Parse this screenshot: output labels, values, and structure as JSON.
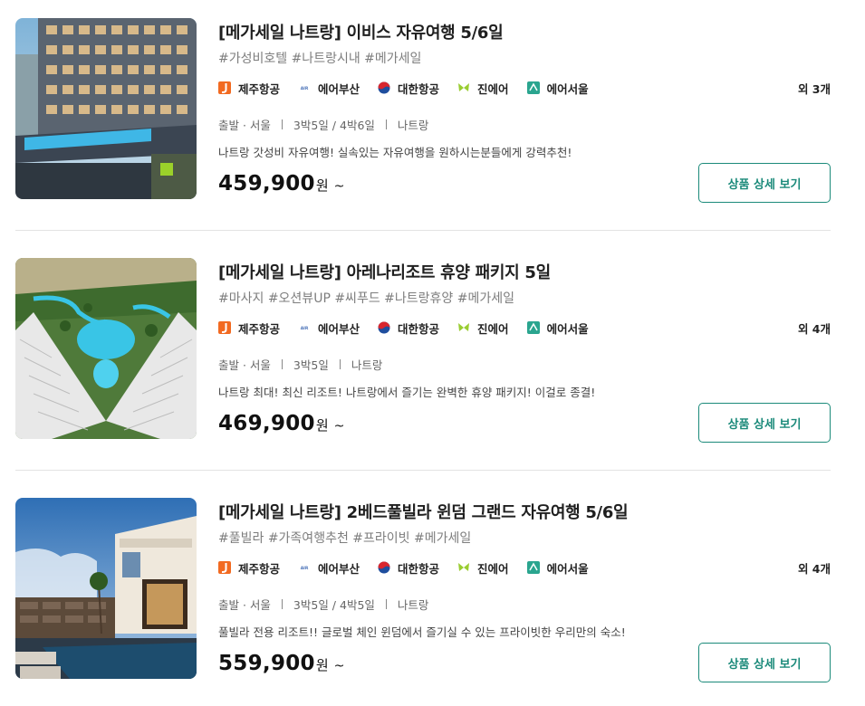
{
  "colors": {
    "accent": "#1b8a7a",
    "tag_text": "#7d7d7d",
    "divider": "#e3e3e3",
    "jeju_air": "#f26a21",
    "air_busan": "#4a72b8",
    "korean_air_red": "#d9262e",
    "korean_air_blue": "#1f4e9e",
    "jin_air": "#9acd32",
    "air_seoul": "#2aa58f"
  },
  "products": [
    {
      "title": "[메가세일 나트랑] 이비스 자유여행 5/6일",
      "tags": "#가성비호텔 #나트랑시내 #메가세일",
      "airlines": [
        {
          "name": "제주항공",
          "icon": "jeju-air-icon"
        },
        {
          "name": "에어부산",
          "icon": "air-busan-icon"
        },
        {
          "name": "대한항공",
          "icon": "korean-air-icon"
        },
        {
          "name": "진에어",
          "icon": "jin-air-icon"
        },
        {
          "name": "에어서울",
          "icon": "air-seoul-icon"
        }
      ],
      "more_airlines": "외 3개",
      "departure": "출발 · 서울",
      "duration": "3박5일 / 4박6일",
      "destination": "나트랑",
      "description": "나트랑 갓성비 자유여행! 실속있는 자유여행을 원하시는분들에게 강력추천!",
      "price": "459,900",
      "price_unit": "원",
      "price_suffix": "~",
      "button_label": "상품 상세 보기",
      "image": "hotel-pool-photo"
    },
    {
      "title": "[메가세일 나트랑] 아레나리조트 휴양 패키지 5일",
      "tags": "#마사지 #오션뷰UP #씨푸드 #나트랑휴양 #메가세일",
      "airlines": [
        {
          "name": "제주항공",
          "icon": "jeju-air-icon"
        },
        {
          "name": "에어부산",
          "icon": "air-busan-icon"
        },
        {
          "name": "대한항공",
          "icon": "korean-air-icon"
        },
        {
          "name": "진에어",
          "icon": "jin-air-icon"
        },
        {
          "name": "에어서울",
          "icon": "air-seoul-icon"
        }
      ],
      "more_airlines": "외 4개",
      "departure": "출발 · 서울",
      "duration": "3박5일",
      "destination": "나트랑",
      "description": "나트랑 최대! 최신 리조트! 나트랑에서 즐기는 완벽한 휴양 패키지! 이걸로 종결!",
      "price": "469,900",
      "price_unit": "원",
      "price_suffix": "~",
      "button_label": "상품 상세 보기",
      "image": "resort-aerial-photo"
    },
    {
      "title": "[메가세일 나트랑] 2베드풀빌라 윈덤 그랜드 자유여행 5/6일",
      "tags": "#풀빌라 #가족여행추천 #프라이빗 #메가세일",
      "airlines": [
        {
          "name": "제주항공",
          "icon": "jeju-air-icon"
        },
        {
          "name": "에어부산",
          "icon": "air-busan-icon"
        },
        {
          "name": "대한항공",
          "icon": "korean-air-icon"
        },
        {
          "name": "진에어",
          "icon": "jin-air-icon"
        },
        {
          "name": "에어서울",
          "icon": "air-seoul-icon"
        }
      ],
      "more_airlines": "외 4개",
      "departure": "출발 · 서울",
      "duration": "3박5일 / 4박5일",
      "destination": "나트랑",
      "description": "풀빌라 전용 리조트!! 글로벌 체인 윈덤에서 즐기실 수 있는 프라이빗한 우리만의 숙소!",
      "price": "559,900",
      "price_unit": "원",
      "price_suffix": "~",
      "button_label": "상품 상세 보기",
      "image": "pool-villa-photo"
    }
  ]
}
